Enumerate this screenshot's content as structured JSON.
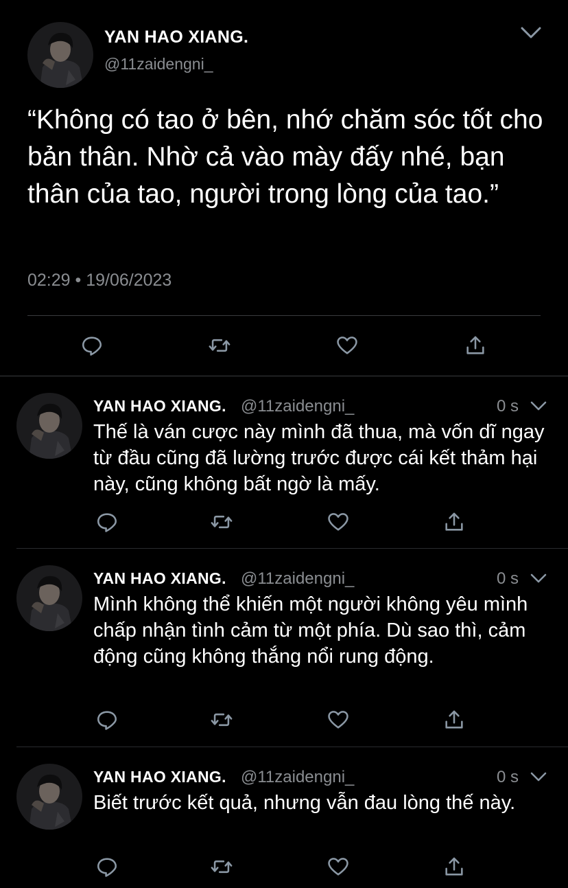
{
  "main_tweet": {
    "display_name": "YAN HAO XIANG.",
    "handle": "@11zaidengni_",
    "text": "“Không có tao ở bên, nhớ chăm sóc tốt cho bản thân. Nhờ cả vào mày đấy nhé, bạn thân của tao, người trong lòng của tao.”",
    "timestamp": "02:29 • 19/06/2023"
  },
  "replies": [
    {
      "display_name": "YAN HAO XIANG.",
      "handle": "@11zaidengni_",
      "time": "0 s",
      "text": "Thế là ván cược này mình đã thua, mà vốn dĩ ngay từ đầu cũng đã lường trước được cái kết thảm hại này, cũng không bất ngờ là mấy."
    },
    {
      "display_name": "YAN HAO XIANG.",
      "handle": "@11zaidengni_",
      "time": "0 s",
      "text": "Mình không thể khiến một người không yêu mình chấp nhận tình cảm từ một phía. Dù sao thì, cảm động cũng không thắng nổi rung động."
    },
    {
      "display_name": "YAN HAO XIANG.",
      "handle": "@11zaidengni_",
      "time": "0 s",
      "text": "Biết trước kết quả, nhưng vẫn đau lòng thế này."
    }
  ],
  "icons": {
    "reply": "reply-bubble-icon",
    "retweet": "retweet-icon",
    "like": "heart-icon",
    "share": "share-icon",
    "menu": "chevron-down-icon"
  },
  "colors": {
    "background": "#000000",
    "text": "#ffffff",
    "secondary": "#8a8d91",
    "icon": "#8b98a5",
    "divider": "#3a3c3f"
  }
}
